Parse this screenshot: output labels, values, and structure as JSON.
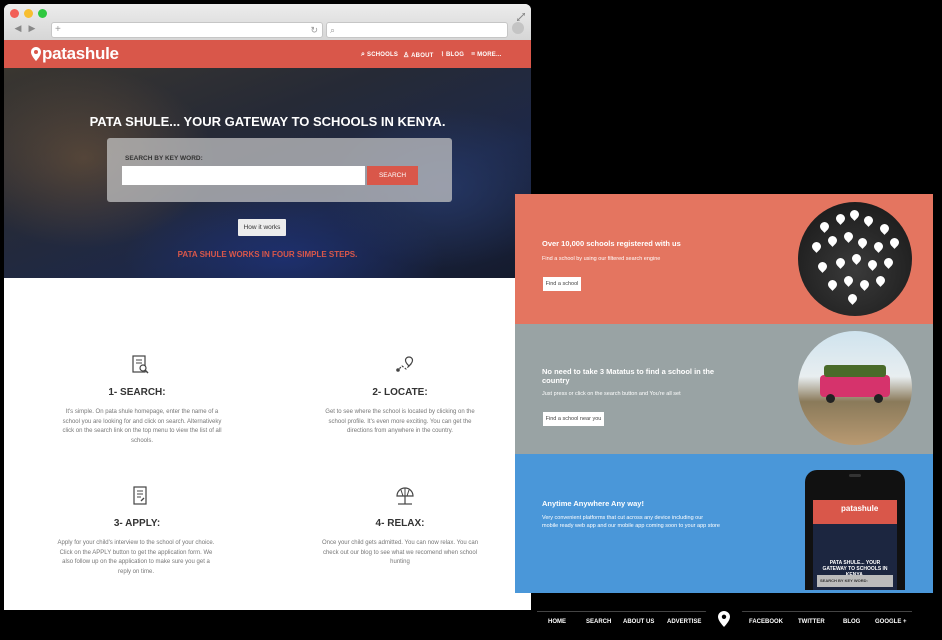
{
  "browser": {
    "nav": {
      "back_icon": "◀",
      "forward_icon": "▶",
      "newtab_icon": "+",
      "reload_icon": "↻",
      "search_icon": "⌕"
    }
  },
  "site": {
    "logo": "patashule",
    "nav": [
      {
        "label": "SCHOOLS",
        "icon": "search-icon"
      },
      {
        "label": "ABOUT",
        "icon": "user-icon"
      },
      {
        "label": "BLOG",
        "icon": "rss-icon"
      },
      {
        "label": "MORE...",
        "icon": "menu-icon"
      }
    ]
  },
  "hero": {
    "title": "PATA SHULE... YOUR GATEWAY TO SCHOOLS IN KENYA.",
    "search_label": "SEARCH BY KEY WORD:",
    "search_placeholder": "",
    "search_button": "SEARCH",
    "how_button": "How it works"
  },
  "steps": {
    "title": "PATA SHULE WORKS IN FOUR SIMPLE STEPS.",
    "items": [
      {
        "title": "1- SEARCH:",
        "icon": "document-search-icon",
        "desc": "It's simple. On pata shule homepage, enter the name of a school you are looking for and click on search. Alternativeky click on the search link on the top menu to view the list of all schools."
      },
      {
        "title": "2- LOCATE:",
        "icon": "map-route-icon",
        "desc": "Get to see where the school is located by clicking on the school profile. It's even more exciting. You can get the directions from anywhere in the country."
      },
      {
        "title": "3- APPLY:",
        "icon": "application-form-icon",
        "desc": "Apply for your child's interview to the school of your choice. Click on the APPLY button to get the application form. We also follow up on the application to make sure you get a reply on time."
      },
      {
        "title": "4- RELAX:",
        "icon": "beach-umbrella-icon",
        "desc": "Once your child gets admitted. You can now relax. You can check out our blog to see what we recomend when school hunting"
      }
    ]
  },
  "panels": [
    {
      "title": "Over 10,000 schools registered with us",
      "desc": "Find a school by using our filtered search engine",
      "button": "Find a school",
      "color": "#e47560"
    },
    {
      "title": "No need to take 3 Matatus to find a school in the country",
      "desc": "Just press or click on the search button and You're all set",
      "button": "Find a school near you",
      "color": "#99a3a4"
    },
    {
      "title": "Anytime Anywhere Any way!",
      "desc": "Very convenient platforms that cut across any device including our mobile ready web app and our mobile app coming soon to your app store",
      "button": "",
      "color": "#4a97d9"
    }
  ],
  "phone": {
    "logo": "patashule",
    "hero_title": "PATA SHULE... YOUR GATEWAY TO SCHOOLS IN KENYA.",
    "search_label": "SEARCH BY KEY WORD:"
  },
  "footer": {
    "links": [
      "HOME",
      "SEARCH",
      "ABOUT US",
      "ADVERTISE",
      "FACEBOOK",
      "TWITTER",
      "BLOG",
      "GOOGLE +"
    ]
  },
  "colors": {
    "brand": "#d9574a",
    "panel_orange": "#e47560",
    "panel_grey": "#99a3a4",
    "panel_blue": "#4a97d9"
  }
}
